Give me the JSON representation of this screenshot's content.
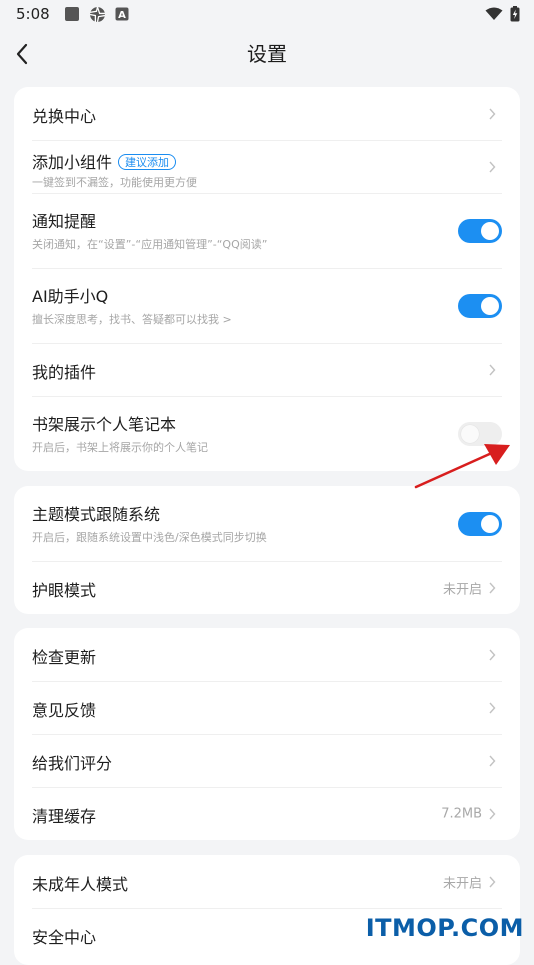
{
  "status": {
    "time": "5:08",
    "icons": [
      "square-icon",
      "aperture-icon",
      "a-box-icon",
      "wifi-icon",
      "battery-charging-icon"
    ],
    "sb_letter": "A"
  },
  "nav": {
    "title": "设置",
    "back_icon": "chevron-left-icon"
  },
  "groups": [
    {
      "items": [
        {
          "title": "兑换中心"
        },
        {
          "title": "添加小组件",
          "badge": "建议添加",
          "subtitle": "一键签到不漏签，功能使用更方便"
        },
        {
          "title": "通知提醒",
          "subtitle": "关闭通知，在“设置”-“应用通知管理”-“QQ阅读”",
          "toggle_on": true
        },
        {
          "title": "AI助手小Q",
          "subtitle": "擅长深度思考，找书、答疑都可以找我 >",
          "toggle_on": true
        },
        {
          "title": "我的插件"
        },
        {
          "title": "书架展示个人笔记本",
          "subtitle": "开启后，书架上将展示你的个人笔记",
          "toggle_on": false
        }
      ]
    },
    {
      "items": [
        {
          "title": "主题模式跟随系统",
          "subtitle": "开启后，跟随系统设置中浅色/深色模式同步切换",
          "toggle_on": true
        },
        {
          "title": "护眼模式",
          "value": "未开启"
        }
      ]
    },
    {
      "items": [
        {
          "title": "检查更新"
        },
        {
          "title": "意见反馈"
        },
        {
          "title": "给我们评分"
        },
        {
          "title": "清理缓存",
          "value": "7.2MB"
        }
      ]
    },
    {
      "items": [
        {
          "title": "未成年人模式",
          "value": "未开启"
        },
        {
          "title": "安全中心"
        }
      ]
    }
  ],
  "colors": {
    "accent": "#1c8ff2",
    "annotation_arrow": "#d81e1e",
    "watermark": "#0b5ea8"
  },
  "watermark": "ITMOP.COM"
}
